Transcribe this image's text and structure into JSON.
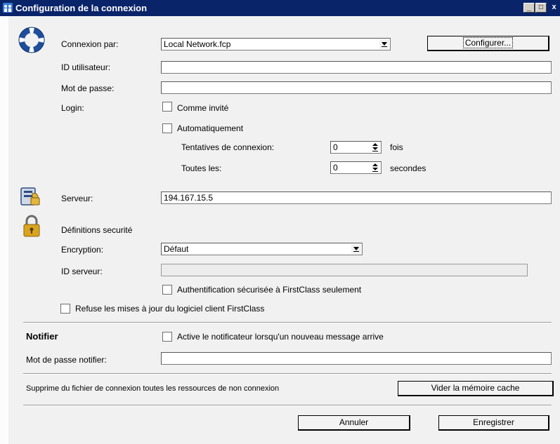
{
  "window": {
    "title": "Configuration de la connexion",
    "controls": {
      "minimize": "_",
      "maximize": "□",
      "close": "x"
    }
  },
  "connection": {
    "via_label": "Connexion par:",
    "via_value": "Local Network.fcp",
    "configure_button": "Configurer...",
    "user_id_label": "ID utilisateur:",
    "user_id_value": "",
    "password_label": "Mot de passe:",
    "password_value": "",
    "login_label": "Login:",
    "as_guest_label": "Comme invité",
    "automatic_label": "Automatiquement",
    "attempts_label": "Tentatives de connexion:",
    "attempts_value": "0",
    "attempts_unit": "fois",
    "every_label": "Toutes les:",
    "every_value": "0",
    "every_unit": "secondes"
  },
  "server": {
    "label": "Serveur:",
    "value": "194.167.15.5"
  },
  "security": {
    "heading": "Définitions securité",
    "encryption_label": "Encryption:",
    "encryption_value": "Défaut",
    "server_id_label": "ID serveur:",
    "server_id_value": "",
    "secure_auth_label": "Authentification sécurisée à FirstClass seulement",
    "refuse_updates_label": "Refuse les mises à jour du logiciel client FirstClass"
  },
  "notifier": {
    "heading": "Notifier",
    "activate_label": "Active le notificateur lorsqu'un nouveau message arrive",
    "password_label": "Mot de passe notifier:",
    "password_value": ""
  },
  "cache": {
    "description": "Supprime du fichier de connexion toutes les ressources de non connexion",
    "clear_button": "Vider la mémoire cache"
  },
  "footer": {
    "cancel_button": "Annuler",
    "save_button": "Enregistrer"
  },
  "colors": {
    "titlebar": "#0a246a",
    "background": "#f1f1f1",
    "connection_icon": "#1f4e9c",
    "lock_icon": "#d9a420"
  },
  "icons": [
    "connection-ring-icon",
    "server-icon",
    "lock-icon",
    "app-icon"
  ]
}
